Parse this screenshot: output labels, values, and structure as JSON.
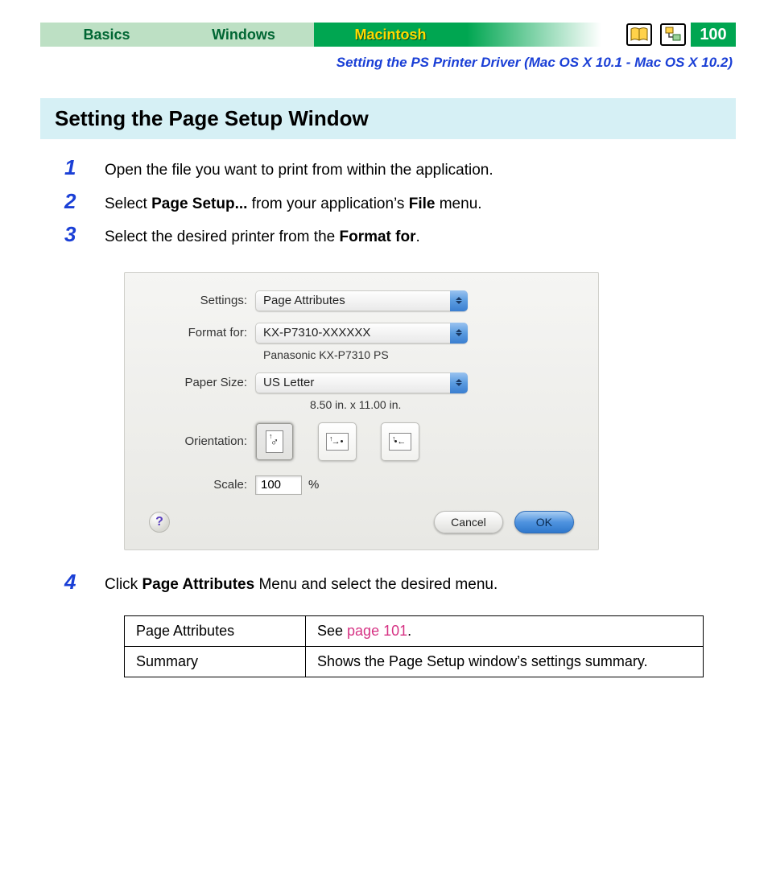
{
  "header": {
    "tabs": {
      "basics": "Basics",
      "windows": "Windows",
      "macintosh": "Macintosh"
    },
    "page_number": "100",
    "breadcrumb": "Setting the PS Printer Driver (Mac OS X 10.1 - Mac OS X 10.2)"
  },
  "section_title": "Setting the Page Setup Window",
  "steps": [
    {
      "num": "1",
      "text_plain": "Open the file you want to print from within the application."
    },
    {
      "num": "2",
      "prefix": "Select ",
      "bold1": "Page Setup...",
      "mid": " from your application’s ",
      "bold2": "File",
      "suffix": " menu."
    },
    {
      "num": "3",
      "prefix": "Select the desired printer from the ",
      "bold1": "Format for",
      "suffix": "."
    },
    {
      "num": "4",
      "prefix": "Click ",
      "bold1": "Page Attributes",
      "suffix": " Menu and select the desired menu."
    }
  ],
  "dialog": {
    "labels": {
      "settings": "Settings:",
      "format_for": "Format for:",
      "paper_size": "Paper Size:",
      "orientation": "Orientation:",
      "scale": "Scale:"
    },
    "values": {
      "settings": "Page Attributes",
      "format_for": "KX-P7310-XXXXXX",
      "format_for_sub": "Panasonic KX-P7310 PS",
      "paper_size": "US Letter",
      "paper_size_sub": "8.50 in. x 11.00 in.",
      "scale": "100",
      "scale_unit": "%"
    },
    "buttons": {
      "help": "?",
      "cancel": "Cancel",
      "ok": "OK"
    }
  },
  "table": {
    "rows": [
      {
        "c1": "Page Attributes",
        "c2_prefix": "See ",
        "c2_link": "page 101",
        "c2_suffix": "."
      },
      {
        "c1": "Summary",
        "c2_plain": "Shows the Page Setup window’s settings summary."
      }
    ]
  }
}
